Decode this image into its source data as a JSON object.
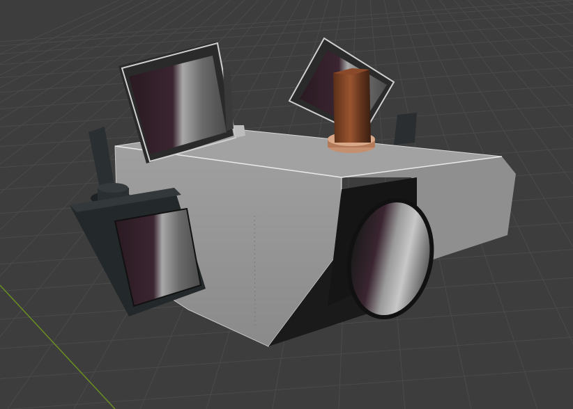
{
  "scene": {
    "background_color": "#3d3d3d",
    "grid_color": "#4a4a4a",
    "axis_y_color": "#6b8e23",
    "body_color": "#9c9c9c",
    "dark_part_color": "#252a2c",
    "copper_color": "#8a4a2a"
  }
}
